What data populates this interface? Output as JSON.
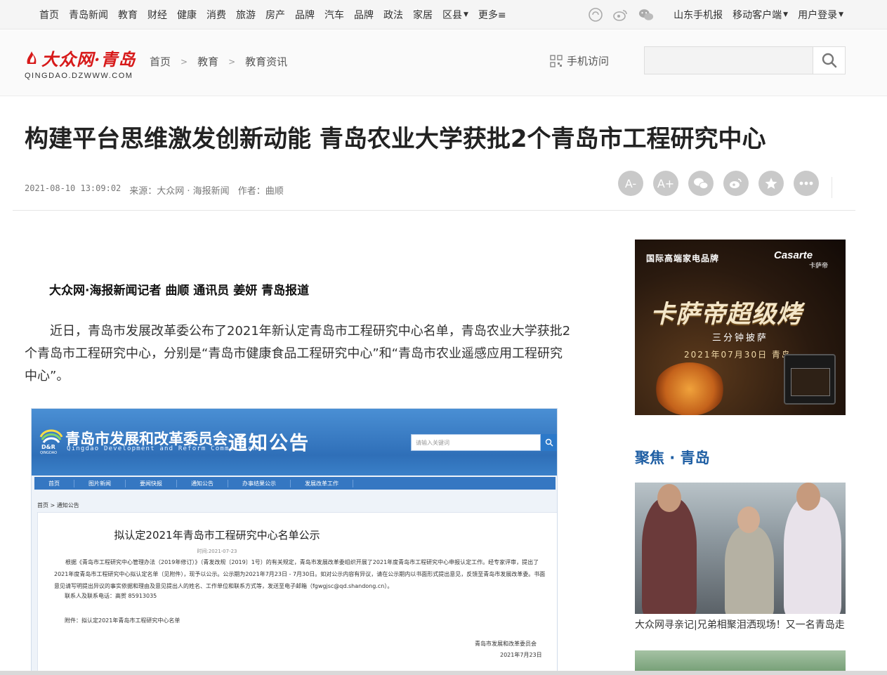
{
  "topnav": {
    "items": [
      {
        "label": "首页"
      },
      {
        "label": "青岛新闻"
      },
      {
        "label": "教育"
      },
      {
        "label": "财经"
      },
      {
        "label": "健康"
      },
      {
        "label": "消费"
      },
      {
        "label": "旅游"
      },
      {
        "label": "房产"
      },
      {
        "label": "品牌"
      },
      {
        "label": "汽车"
      },
      {
        "label": "品牌"
      },
      {
        "label": "政法"
      },
      {
        "label": "家居"
      },
      {
        "label": "区县"
      }
    ],
    "more_label": "更多≡",
    "right_links": {
      "mobile_news": "山东手机报",
      "mobile_client": "移动客户端",
      "login": "用户登录"
    }
  },
  "header": {
    "logo_text": "大众网·青岛",
    "logo_domain": "QINGDAO.DZWWW.COM",
    "breadcrumb": [
      "首页",
      "教育",
      "教育资讯"
    ],
    "mobile_visit": "手机访问",
    "search": {
      "value": "",
      "placeholder": ""
    }
  },
  "article": {
    "title": "构建平台思维激发创新动能 青岛农业大学获批2个青岛市工程研究中心",
    "date": "2021-08-10 13:09:02",
    "source": "来源：大众网 · 海报新闻",
    "author": "作者：曲顺",
    "tools": {
      "font_decrease": "A-",
      "font_increase": "A+"
    },
    "byline": "大众网·海报新闻记者 曲顺 通讯员 姜妍 青岛报道",
    "paragraph1": "近日，青岛市发展改革委公布了2021年新认定青岛市工程研究中心名单，青岛农业大学获批2个青岛市工程研究中心，分别是“青岛市健康食品工程研究中心”和“青岛市农业遥感应用工程研究中心”。"
  },
  "embed": {
    "org_name": "青岛市发展和改革委员会",
    "org_name_en": "Qingdao Development and Reform Commission",
    "logo_text": "D&R",
    "logo_sub": "QINGDAO",
    "section_tag": "通知公告",
    "search_placeholder": "请输入关键词",
    "nav": [
      "首页",
      "图片新闻",
      "要闻快报",
      "通知公告",
      "办事结果公示",
      "发展改革工作"
    ],
    "crumb": "首页 > 通知公告",
    "doc_title": "拟认定2021年青岛市工程研究中心名单公示",
    "doc_time": "时间:2021-07-23",
    "doc_body": "根据《青岛市工程研究中心管理办法（2019年修订）》（青发改规〔2019〕1号）的有关规定，青岛市发展改革委组织开展了2021年度青岛市工程研究中心申报认定工作。经专家评审，提出了2021年度青岛市工程研究中心拟认定名单（见附件），现予以公示。公示期为2021年7月23日 - 7月30日。如对公示内容有异议，请在公示期内以书面形式提出意见，反馈至青岛市发展改革委。书面意见请写明提出异议的事实依据和理由及意见提出人的姓名、工作单位和联系方式等，发送至电子邮箱（fgwgjsc@qd.shandong.cn）。",
    "contact": "联系人及联系电话：高贺  85913035",
    "attachment": "附件：拟认定2021年青岛市工程研究中心名单",
    "signature": "青岛市发展和改革委员会",
    "signature_date": "2021年7月23日"
  },
  "sidebar": {
    "ad": {
      "brand_left": "国际高端家电品牌",
      "brand_right": "Casarte",
      "brand_right_cn": "卡萨帝",
      "headline": "卡萨帝超级烤",
      "tagline": "三分钟披萨",
      "date_line": "2021年07月30日  青岛"
    },
    "focus_title": "聚焦 · 青岛",
    "news": [
      {
        "caption": "大众网寻亲记|兄弟相聚泪洒现场！又一名青岛走"
      }
    ]
  },
  "colors": {
    "brand_red": "#d71a1a",
    "focus_blue": "#1e5ea3",
    "tool_gray": "#c9c9c9"
  }
}
